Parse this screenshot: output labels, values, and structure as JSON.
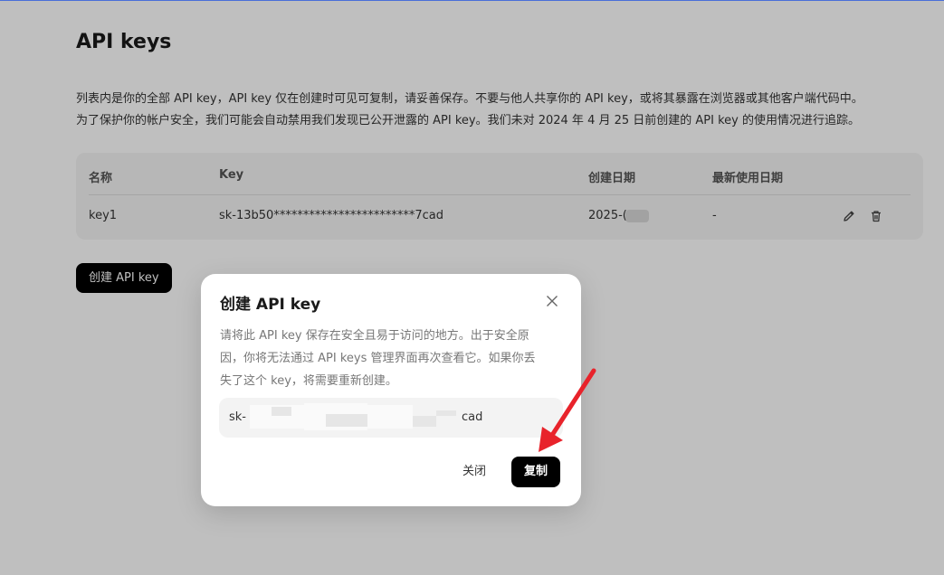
{
  "page": {
    "title": "API keys",
    "description_lines": [
      "列表内是你的全部 API key，API key 仅在创建时可见可复制，请妥善保存。不要与他人共享你的 API key，或将其暴露在浏览器或其他客户端代码中。",
      "为了保护你的帐户安全，我们可能会自动禁用我们发现已公开泄露的 API key。我们未对 2024 年 4 月 25 日前创建的 API key 的使用情况进行追踪。"
    ]
  },
  "table": {
    "headers": [
      "名称",
      "Key",
      "创建日期",
      "最新使用日期"
    ],
    "rows": [
      {
        "name": "key1",
        "key": "sk-13b50************************7cad",
        "created": "2025-(",
        "last_used": "-"
      }
    ],
    "row_actions": [
      "pencil-icon",
      "trash-icon"
    ]
  },
  "create_button": "创建 API key",
  "modal": {
    "title": "创建 API key",
    "description_lines": [
      "请将此 API key 保存在安全且易于访问的地方。出于安全原",
      "因，你将无法通过 API keys 管理界面再次查看它。如果你丢",
      "失了这个 key，将需要重新创建。"
    ],
    "key_prefix": "sk-",
    "key_suffix": "cad",
    "close_label": "关闭",
    "copy_label": "复制"
  },
  "colors": {
    "primary_button": "#000000",
    "overlay": "rgba(0,0,0,0.25)",
    "annotation_arrow": "#e8232b"
  }
}
